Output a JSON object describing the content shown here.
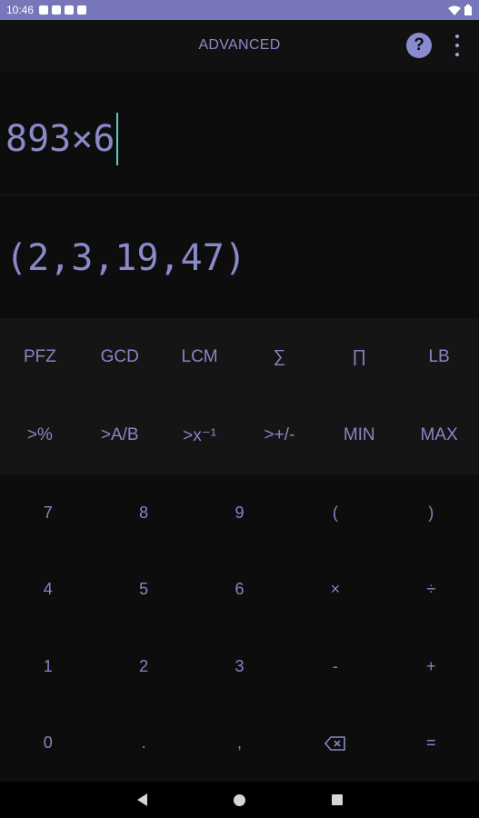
{
  "status": {
    "time": "10:46"
  },
  "appbar": {
    "title": "ADVANCED",
    "help_label": "?"
  },
  "display": {
    "expression": "893×6",
    "result": "(2,3,19,47)"
  },
  "advanced_keys": [
    "PFZ",
    "GCD",
    "LCM",
    "∑",
    "∏",
    "LB",
    ">%",
    ">A/B",
    ">x⁻¹",
    ">+/-",
    "MIN",
    "MAX"
  ],
  "keypad": [
    "7",
    "8",
    "9",
    "(",
    ")",
    "4",
    "5",
    "6",
    "×",
    "÷",
    "1",
    "2",
    "3",
    "-",
    "+",
    "0",
    ".",
    ",",
    "⌫",
    "="
  ],
  "colors": {
    "accent": "#8a8ac8",
    "status_bar": "#7676b8",
    "caret": "#5fc9c2",
    "background": "#0b0b0c"
  }
}
